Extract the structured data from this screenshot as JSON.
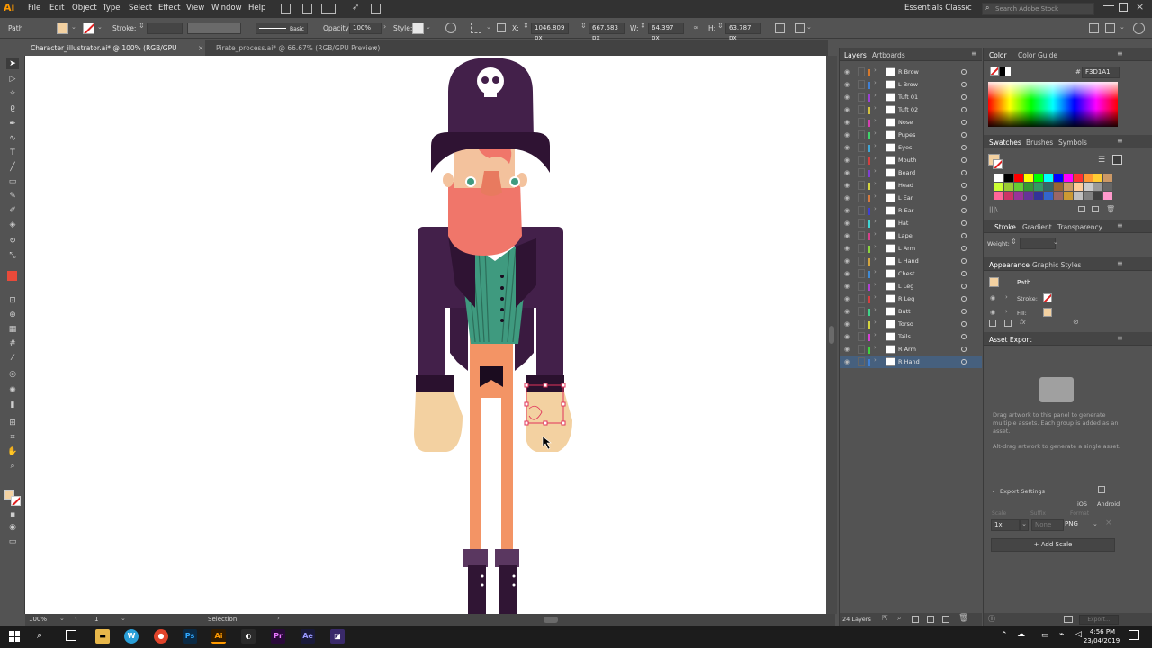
{
  "menubar": {
    "logo": "Ai",
    "items": [
      "File",
      "Edit",
      "Object",
      "Type",
      "Select",
      "Effect",
      "View",
      "Window",
      "Help"
    ],
    "workspace": "Essentials Classic",
    "search_placeholder": "Search Adobe Stock"
  },
  "control": {
    "selection_label": "Path",
    "stroke_label": "Stroke:",
    "brush_label": "Basic",
    "opacity_label": "Opacity:",
    "opacity_value": "100%",
    "style_label": "Style:",
    "x_label": "X:",
    "x_value": "1046.809 px",
    "y_value": "667.583 px",
    "w_label": "W:",
    "w_value": "64.397 px",
    "h_label": "H:",
    "h_value": "63.787 px"
  },
  "tabs": [
    {
      "label": "Character_illustrator.ai* @ 100% (RGB/GPU Preview)",
      "close": "×"
    },
    {
      "label": "Pirate_process.ai* @ 66.67% (RGB/GPU Preview)",
      "close": "×"
    }
  ],
  "layers_panel": {
    "tabs": [
      "Layers",
      "Artboards"
    ],
    "rows": [
      {
        "name": "R Brow",
        "color": "#d6792c"
      },
      {
        "name": "L Brow",
        "color": "#3f7fd4"
      },
      {
        "name": "Tuft 01",
        "color": "#9b3fd4"
      },
      {
        "name": "Tuft 02",
        "color": "#d4c23f"
      },
      {
        "name": "Nose",
        "color": "#d43fb0"
      },
      {
        "name": "Pupes",
        "color": "#3fd46a"
      },
      {
        "name": "Eyes",
        "color": "#3fa5d4"
      },
      {
        "name": "Mouth",
        "color": "#d43f3f"
      },
      {
        "name": "Beard",
        "color": "#7f3fd4"
      },
      {
        "name": "Head",
        "color": "#d4d43f"
      },
      {
        "name": "L Ear",
        "color": "#d4793f"
      },
      {
        "name": "R Ear",
        "color": "#3f3fd4"
      },
      {
        "name": "Hat",
        "color": "#3fd4d4"
      },
      {
        "name": "Lapel",
        "color": "#d43f8a"
      },
      {
        "name": "L Arm",
        "color": "#8ad43f"
      },
      {
        "name": "L Hand",
        "color": "#d4a53f"
      },
      {
        "name": "Chest",
        "color": "#3f8ad4"
      },
      {
        "name": "L Leg",
        "color": "#b03fd4"
      },
      {
        "name": "R Leg",
        "color": "#d43f3f"
      },
      {
        "name": "Butt",
        "color": "#3fd48a"
      },
      {
        "name": "Torso",
        "color": "#d4d43f"
      },
      {
        "name": "Tails",
        "color": "#d43fd4"
      },
      {
        "name": "R Arm",
        "color": "#3fd43f"
      },
      {
        "name": "R Hand",
        "color": "#3f7fd4"
      }
    ],
    "selected_row": "R Hand",
    "layer_count": "24 Layers"
  },
  "color_panel": {
    "tabs": [
      "Color",
      "Color Guide"
    ],
    "hex_symbol": "#",
    "hex_value": "F3D1A1",
    "fill_color": "#F3D1A1"
  },
  "swatches_panel": {
    "tabs": [
      "Swatches",
      "Brushes",
      "Symbols"
    ],
    "colors": [
      "#ffffff",
      "#000000",
      "#ff0000",
      "#ffff00",
      "#00ff00",
      "#00ffff",
      "#0000ff",
      "#ff00ff",
      "#ff3333",
      "#ff9933",
      "#ffcc33",
      "#cc9966",
      "#ccff33",
      "#99cc33",
      "#66cc33",
      "#339933",
      "#339966",
      "#336666",
      "#996633",
      "#cc9966",
      "#ffcc99",
      "#cccccc",
      "#999999",
      "#666666",
      "#ff6699",
      "#cc3366",
      "#993399",
      "#663399",
      "#333399",
      "#3366cc",
      "#996666",
      "#cc9933",
      "#c0c0c0",
      "#808080",
      "#404040",
      "#ff99cc"
    ]
  },
  "stroke_panel": {
    "tabs": [
      "Stroke",
      "Gradient",
      "Transparency"
    ],
    "weight_label": "Weight:"
  },
  "appearance_panel": {
    "tabs": [
      "Appearance",
      "Graphic Styles"
    ],
    "title": "Path",
    "stroke_label": "Stroke:",
    "fill_label": "Fill:",
    "fx_label": "fx"
  },
  "asset_export": {
    "title": "Asset Export",
    "hint1": "Drag artwork to this panel to generate multiple assets. Each group is added as an asset.",
    "hint2": "Alt-drag artwork to generate a single asset.",
    "export_settings": "Export Settings",
    "ios": "iOS",
    "android": "Android",
    "scale_label": "Scale",
    "suffix_label": "Suffix",
    "format_label": "Format",
    "scale_value": "1x",
    "suffix_placeholder": "None",
    "format_value": "PNG",
    "add_scale": "Add Scale",
    "export_button": "Export..."
  },
  "status": {
    "zoom": "100%",
    "artboard": "1",
    "tool": "Selection"
  },
  "taskbar": {
    "time": "4:56 PM",
    "date": "23/04/2019"
  }
}
